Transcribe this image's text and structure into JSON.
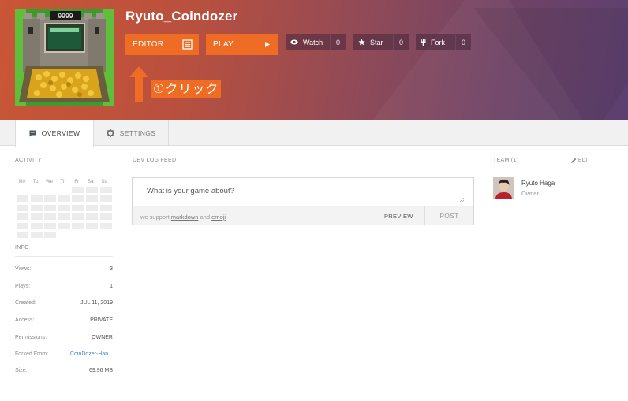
{
  "project": {
    "title": "Ryuto_Coindozer"
  },
  "thumbnail": {
    "score_text": "9999"
  },
  "actions": {
    "editor_label": "EDITOR",
    "play_label": "PLAY",
    "watch_label": "Watch",
    "watch_count": "0",
    "star_label": "Star",
    "star_count": "0",
    "fork_label": "Fork",
    "fork_count": "0"
  },
  "annotation": {
    "text": "①クリック"
  },
  "tabs": [
    {
      "label": "OVERVIEW",
      "active": true,
      "icon": "chat-bubble-icon"
    },
    {
      "label": "SETTINGS",
      "active": false,
      "icon": "gear-icon"
    }
  ],
  "activity": {
    "heading": "ACTIVITY",
    "days": [
      "Mo",
      "Tu",
      "We",
      "Th",
      "Fr",
      "Sa",
      "Su"
    ]
  },
  "info": {
    "heading": "INFO",
    "rows": [
      {
        "label": "Views:",
        "value": "3"
      },
      {
        "label": "Plays:",
        "value": "1"
      },
      {
        "label": "Created:",
        "value": "JUL 11, 2019"
      },
      {
        "label": "Access:",
        "value": "PRIVATE"
      },
      {
        "label": "Permissions:",
        "value": "OWNER"
      },
      {
        "label": "Forked From:",
        "value": "CoinDozer-Han..."
      },
      {
        "label": "Size:",
        "value": "69.96 MB"
      }
    ]
  },
  "devlog": {
    "heading": "DEV LOG FEED",
    "placeholder": "What is your game about?",
    "support_prefix": "we support",
    "support_markdown": "markdown",
    "support_and": "and",
    "support_emoji": "emoji",
    "preview_label": "PREVIEW",
    "post_label": "POST"
  },
  "team": {
    "heading": "TEAM (1)",
    "edit_label": "EDIT",
    "members": [
      {
        "name": "Ryuto Haga",
        "role": "Owner"
      }
    ]
  },
  "colors": {
    "accent": "#ef6c24",
    "link": "#3d87c9"
  }
}
